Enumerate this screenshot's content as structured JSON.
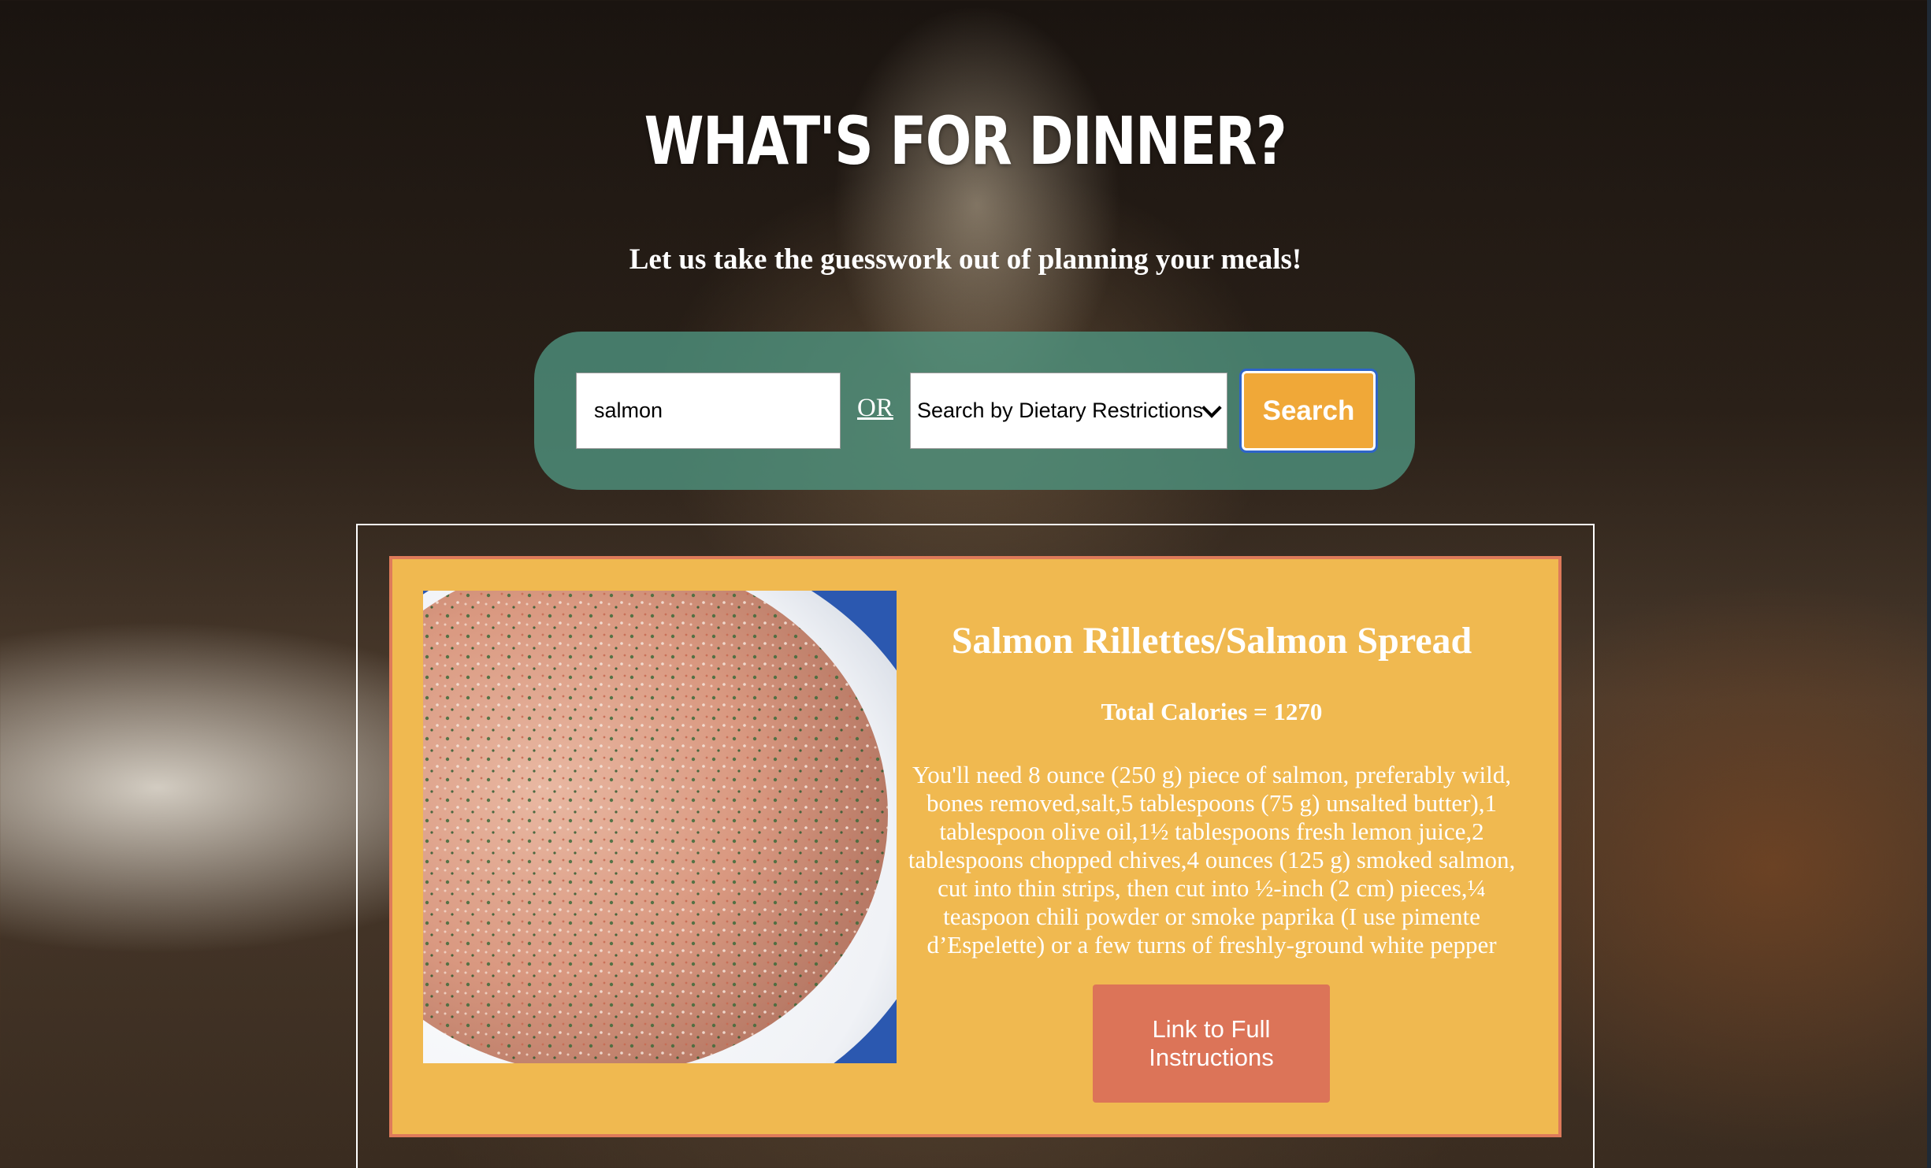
{
  "header": {
    "title": "WHAT'S FOR DINNER?",
    "subtitle": "Let us take the guesswork out of planning your meals!"
  },
  "search": {
    "query_value": "salmon",
    "or_label": "OR",
    "dietary_select_value": "Search by Dietary Restrictions",
    "button_label": "Search"
  },
  "results": [
    {
      "title": "Salmon Rillettes/Salmon Spread",
      "calories": "Total Calories = 1270",
      "ingredients": "You'll need 8 ounce (250 g) piece of salmon, preferably wild, bones removed,salt,5 tablespoons (75 g) unsalted butter),1 tablespoon olive oil,1½ tablespoons fresh lemon juice,2 tablespoons chopped chives,4 ounces (125 g) smoked salmon, cut into thin strips, then cut into ½-inch (2 cm) pieces,¼ teaspoon chili powder or smoke paprika (I use pimente d’Espelette) or a few turns of freshly-ground white pepper",
      "link_label": "Link to Full Instructions"
    }
  ],
  "colors": {
    "search_bar": "#50968a",
    "search_button": "#f0a838",
    "card_background": "#f0b950",
    "card_border": "#de7a5a",
    "link_button": "#dc7458"
  }
}
